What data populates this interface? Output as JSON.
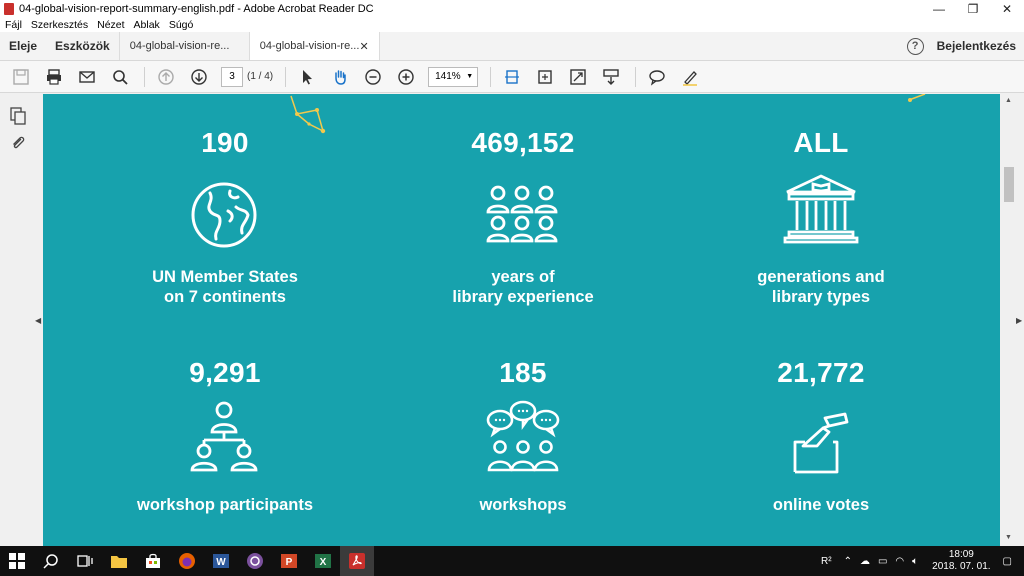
{
  "window": {
    "title": "04-global-vision-report-summary-english.pdf - Adobe Acrobat Reader DC",
    "minimize": "—",
    "restore": "❐",
    "close": "✕"
  },
  "menu": [
    "Fájl",
    "Szerkesztés",
    "Nézet",
    "Ablak",
    "Súgó"
  ],
  "tabs": {
    "home": "Eleje",
    "tools": "Eszközök",
    "doc1": "04-global-vision-re...",
    "doc2": "04-global-vision-re...",
    "close": "✕",
    "help": "?",
    "signin": "Bejelentkezés"
  },
  "toolbar": {
    "page_value": "3",
    "page_count": "(1 / 4)",
    "zoom": "141%"
  },
  "stats": [
    {
      "number": "190",
      "line1": "UN Member States",
      "line2": "on 7 continents",
      "icon": "globe-icon"
    },
    {
      "number": "469,152",
      "line1": "years of",
      "line2": "library experience",
      "icon": "audience-icon"
    },
    {
      "number": "ALL",
      "line1": "generations and",
      "line2": "library types",
      "icon": "library-building-icon"
    },
    {
      "number": "9,291",
      "line1": "workshop participants",
      "line2": "",
      "icon": "org-chart-people-icon"
    },
    {
      "number": "185",
      "line1": "workshops",
      "line2": "",
      "icon": "discussion-group-icon"
    },
    {
      "number": "21,772",
      "line1": "online votes",
      "line2": "",
      "icon": "ballot-vote-icon"
    }
  ],
  "taskbar": {
    "time": "18:09",
    "date": "2018. 07. 01."
  },
  "colors": {
    "page_background": "#17a2ad",
    "accent_gold": "#f2c94c"
  }
}
